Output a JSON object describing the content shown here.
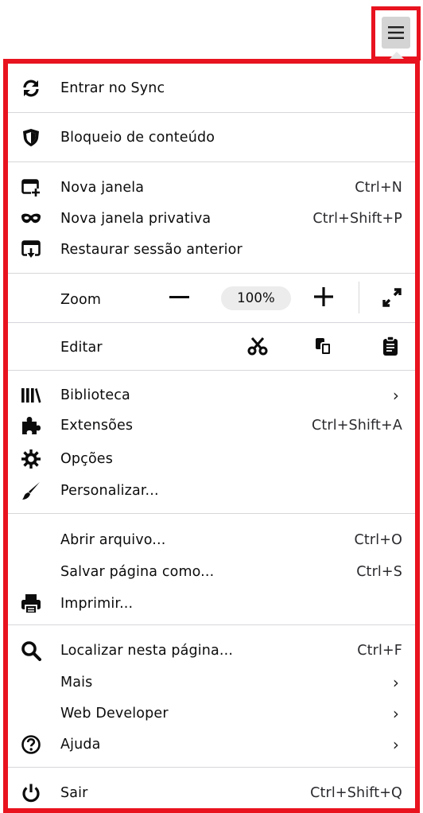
{
  "menu": {
    "sync": "Entrar no Sync",
    "content_blocking": "Bloqueio de conteúdo",
    "new_window": {
      "label": "Nova janela",
      "shortcut": "Ctrl+N"
    },
    "private_window": {
      "label": "Nova janela privativa",
      "shortcut": "Ctrl+Shift+P"
    },
    "restore_session": "Restaurar sessão anterior",
    "zoom": {
      "label": "Zoom",
      "value": "100%"
    },
    "edit": {
      "label": "Editar"
    },
    "library": "Biblioteca",
    "addons": {
      "label": "Extensões",
      "shortcut": "Ctrl+Shift+A"
    },
    "options": "Opções",
    "customize": "Personalizar...",
    "open_file": {
      "label": "Abrir arquivo...",
      "shortcut": "Ctrl+O"
    },
    "save_page": {
      "label": "Salvar página como...",
      "shortcut": "Ctrl+S"
    },
    "print": "Imprimir...",
    "find": {
      "label": "Localizar nesta página...",
      "shortcut": "Ctrl+F"
    },
    "more": "Mais",
    "web_developer": "Web Developer",
    "help": "Ajuda",
    "quit": {
      "label": "Sair",
      "shortcut": "Ctrl+Shift+Q"
    }
  },
  "icons": {
    "sync": "sync-icon",
    "shield": "shield-icon",
    "new_window": "new-window-icon",
    "private": "mask-icon",
    "restore": "restore-session-icon",
    "cut": "scissors-icon",
    "copy": "copy-icon",
    "paste": "clipboard-icon",
    "library": "library-icon",
    "addons": "puzzle-icon",
    "options": "gear-icon",
    "customize": "brush-icon",
    "print": "printer-icon",
    "find": "search-icon",
    "help": "help-icon",
    "quit": "power-icon",
    "menu": "hamburger-menu-icon"
  },
  "colors": {
    "highlight": "#e8131f"
  }
}
